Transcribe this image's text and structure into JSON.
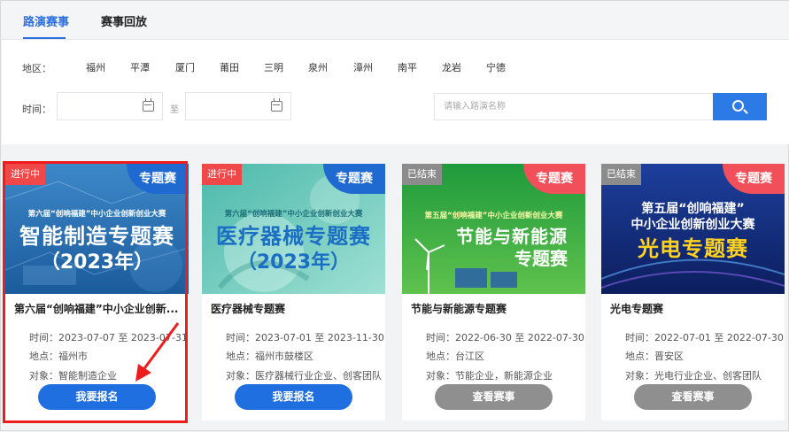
{
  "tabs": [
    {
      "label": "路演赛事"
    },
    {
      "label": "赛事回放"
    }
  ],
  "filters": {
    "region_label": "地区：",
    "regions": [
      "福州",
      "平潭",
      "厦门",
      "莆田",
      "三明",
      "泉州",
      "漳州",
      "南平",
      "龙岩",
      "宁德"
    ],
    "time_label": "时间：",
    "to_label": "至",
    "search_placeholder": "请输入路演名称"
  },
  "cards": [
    {
      "status": "进行中",
      "tag": "专题赛",
      "banner_line1": "第六届“创响福建”中小企业创新创业大赛",
      "banner_line2": "智能制造专题赛",
      "banner_line3": "（2023年）",
      "title": "第六届“创响福建”中小企业创新...",
      "time": "时间：2023-07-07 至 2023-07-31",
      "place": "地点：福州市",
      "target": "对象：智能制造企业",
      "button": "我要报名"
    },
    {
      "status": "进行中",
      "tag": "专题赛",
      "banner_line1": "第六届“创响福建”中小企业创新创业大赛",
      "banner_line2": "医疗器械专题赛",
      "banner_line3": "（2023年）",
      "title": "医疗器械专题赛",
      "time": "时间：2023-07-01 至 2023-11-30",
      "place": "地点：福州市鼓楼区",
      "target": "对象：医疗器械行业企业、创客团队",
      "button": "我要报名"
    },
    {
      "status": "已结束",
      "tag": "专题赛",
      "banner_line1": "第五届“创响福建”中小企业创新创业大赛",
      "banner_line2": "节能与新能源",
      "banner_line3": "专题赛",
      "title": "节能与新能源专题赛",
      "time": "时间：2022-06-30 至 2022-07-30",
      "place": "地点：台江区",
      "target": "对象：节能企业，新能源企业",
      "button": "查看赛事"
    },
    {
      "status": "已结束",
      "tag": "专题赛",
      "banner_line1": "第五届“创响福建”",
      "banner_line2": "中小企业创新创业大赛",
      "banner_line3": "光电专题赛",
      "title": "光电专题赛",
      "time": "时间：2022-07-01 至 2022-07-30",
      "place": "地点：晋安区",
      "target": "对象：光电行业企业、创客团队",
      "button": "查看赛事"
    }
  ],
  "colors": {
    "accent": "#2b7ae6",
    "register_button": "#1f6fe0",
    "view_button": "#8f8f8f",
    "status_active": "#f04848",
    "status_ended": "#8c8c8c",
    "highlight": "#ee1c1c"
  }
}
